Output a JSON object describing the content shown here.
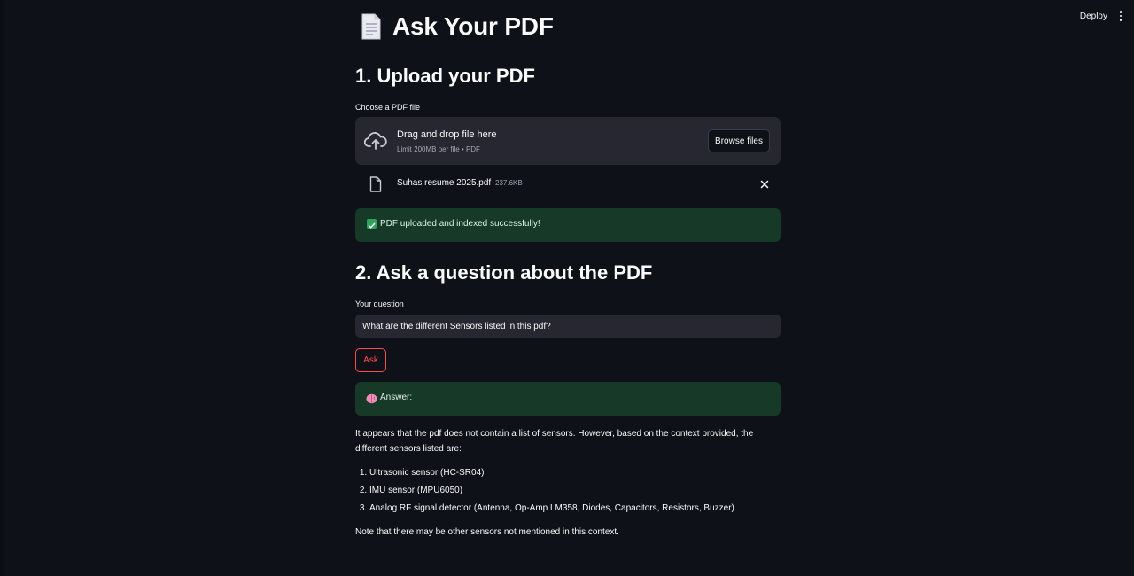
{
  "header": {
    "deploy_label": "Deploy",
    "menu_icon": "kebab-menu-icon"
  },
  "page": {
    "title": "Ask Your PDF",
    "title_icon": "document-icon"
  },
  "upload_section": {
    "heading": "1. Upload your PDF",
    "field_label": "Choose a PDF file",
    "dropzone": {
      "title": "Drag and drop file here",
      "subtitle": "Limit 200MB per file • PDF",
      "icon": "cloud-upload-icon"
    },
    "browse_label": "Browse files",
    "uploaded_file": {
      "name": "Suhas resume 2025.pdf",
      "size": "237.6KB",
      "icon": "file-icon"
    },
    "success_message": "PDF uploaded and indexed successfully!"
  },
  "question_section": {
    "heading": "2. Ask a question about the PDF",
    "field_label": "Your question",
    "question_value": "What are the different Sensors listed in this pdf?",
    "ask_label": "Ask",
    "answer_header": "Answer:",
    "answer": {
      "intro": "It appears that the pdf does not contain a list of sensors. However, based on the context provided, the different sensors listed are:",
      "items": [
        "Ultrasonic sensor (HC-SR04)",
        "IMU sensor (MPU6050)",
        "Analog RF signal detector (Antenna, Op-Amp LM358, Diodes, Capacitors, Resistors, Buzzer)"
      ],
      "note": "Note that there may be other sensors not mentioned in this context."
    }
  },
  "colors": {
    "background": "#0e1117",
    "surface": "#262730",
    "success_bg": "#173928",
    "accent": "#ff4b4b"
  }
}
